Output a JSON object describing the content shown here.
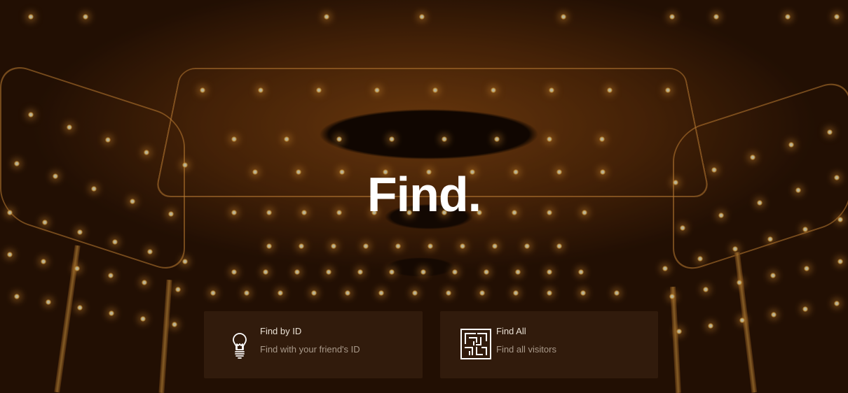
{
  "hero": {
    "title": "Find."
  },
  "options": [
    {
      "title": "Find by ID",
      "subtitle": "Find with your friend's ID",
      "icon": "lightbulb-icon"
    },
    {
      "title": "Find All",
      "subtitle": "Find all visitors",
      "icon": "maze-icon"
    }
  ],
  "colors": {
    "title_text": "#ffffff",
    "card_background": "#3c2412",
    "card_title": "#e9e0d4",
    "card_subtitle": "#a8998a"
  }
}
